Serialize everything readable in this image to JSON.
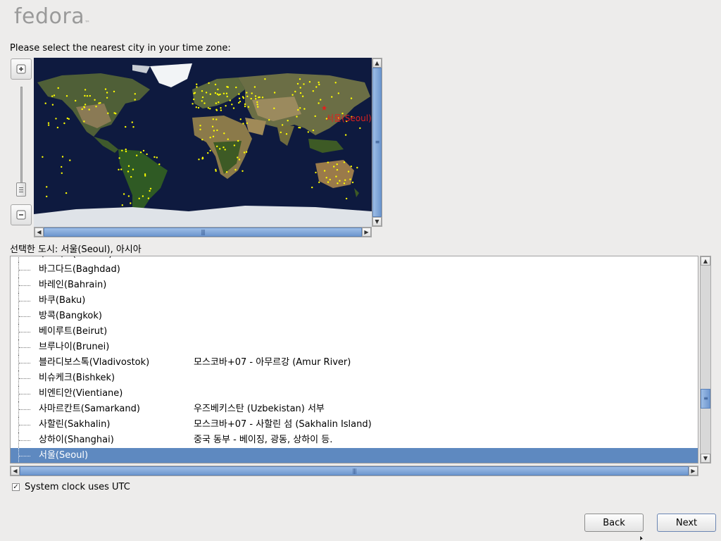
{
  "branding": {
    "logo_text": "fedora",
    "logo_mark": "™"
  },
  "prompt": "Please select the nearest city in your time zone:",
  "map": {
    "marker_label": "서울(Seoul)",
    "marker_color": "#e0201e",
    "city_dot_color": "#ffff00",
    "ocean_color": "#0e1a3f"
  },
  "zoom": {
    "in_icon": "zoom-in-icon",
    "out_icon": "zoom-out-icon"
  },
  "selected_city_label": "선택한 도시: 서울(Seoul), 아시아",
  "cities": [
    {
      "name": "무스카트(Muscat)",
      "desc": ""
    },
    {
      "name": "바그다드(Baghdad)",
      "desc": ""
    },
    {
      "name": "바레인(Bahrain)",
      "desc": ""
    },
    {
      "name": "바쿠(Baku)",
      "desc": ""
    },
    {
      "name": "방콕(Bangkok)",
      "desc": ""
    },
    {
      "name": "베이루트(Beirut)",
      "desc": ""
    },
    {
      "name": "브루나이(Brunei)",
      "desc": ""
    },
    {
      "name": "블라디보스톡(Vladivostok)",
      "desc": "모스코바+07 - 아무르강 (Amur River)"
    },
    {
      "name": "비슈케크(Bishkek)",
      "desc": ""
    },
    {
      "name": "비엔티안(Vientiane)",
      "desc": ""
    },
    {
      "name": "사마르칸트(Samarkand)",
      "desc": "우즈베키스탄 (Uzbekistan) 서부"
    },
    {
      "name": "사할린(Sakhalin)",
      "desc": "모스크바+07 - 사할린 섬 (Sakhalin Island)"
    },
    {
      "name": "상하이(Shanghai)",
      "desc": "중국 동부 - 베이징, 광동, 상하이 등."
    },
    {
      "name": "서울(Seoul)",
      "desc": ""
    }
  ],
  "selected_index": 13,
  "utc": {
    "label": "System clock uses UTC",
    "checked": true
  },
  "buttons": {
    "back": "Back",
    "next": "Next"
  },
  "colors": {
    "selection": "#5e89c0",
    "scroll_thumb": "#6e97cf"
  }
}
